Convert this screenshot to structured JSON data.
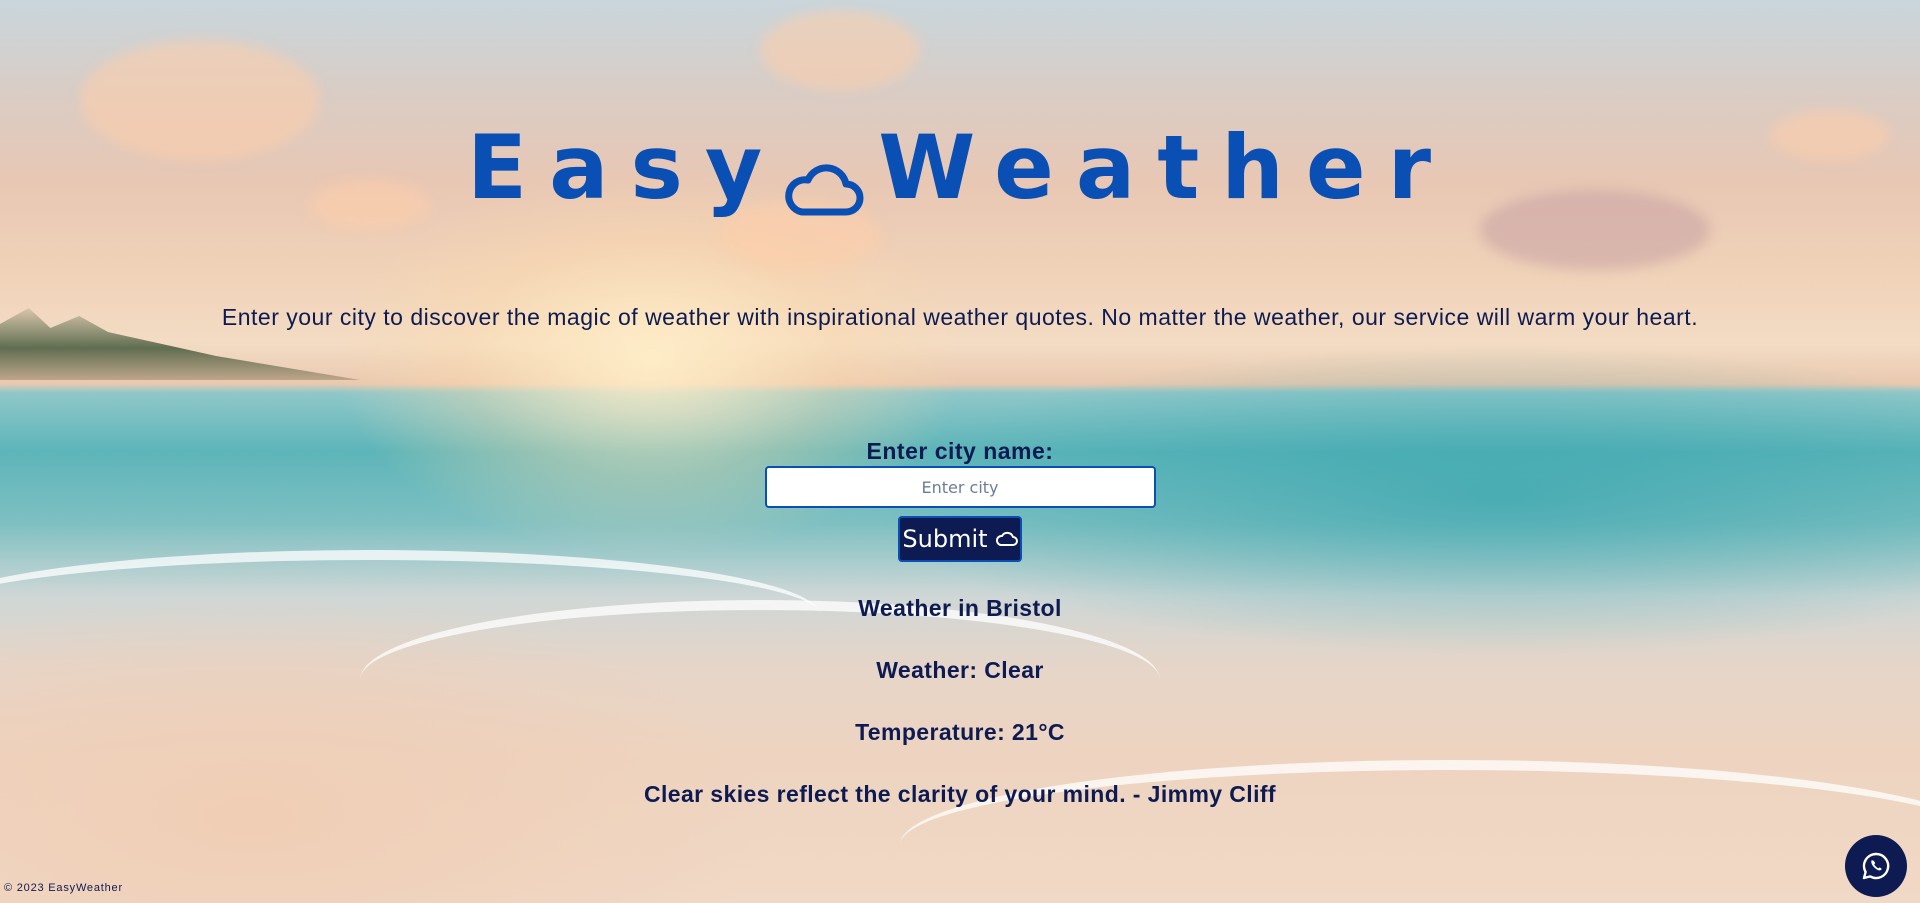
{
  "header": {
    "title_left": "Easy",
    "title_right": "Weather",
    "title_icon": "cloud-icon",
    "title_color": "#0a4fb4"
  },
  "intro": {
    "text": "Enter your city to discover the magic of weather with inspirational weather quotes. No matter the weather, our service will warm your heart."
  },
  "form": {
    "label": "Enter city name:",
    "input_value": "",
    "input_placeholder": "Enter city",
    "submit_label": "Submit",
    "submit_icon": "cloud-icon",
    "button_color": "#0d1b52"
  },
  "result": {
    "heading": "Weather in Bristol",
    "weather": "Weather: Clear",
    "temperature": "Temperature: 21°C",
    "quote": "Clear skies reflect the clarity of your mind. - Jimmy Cliff"
  },
  "footer": {
    "copyright": "© 2023 EasyWeather"
  },
  "floating_button": {
    "icon": "whatsapp-icon"
  }
}
